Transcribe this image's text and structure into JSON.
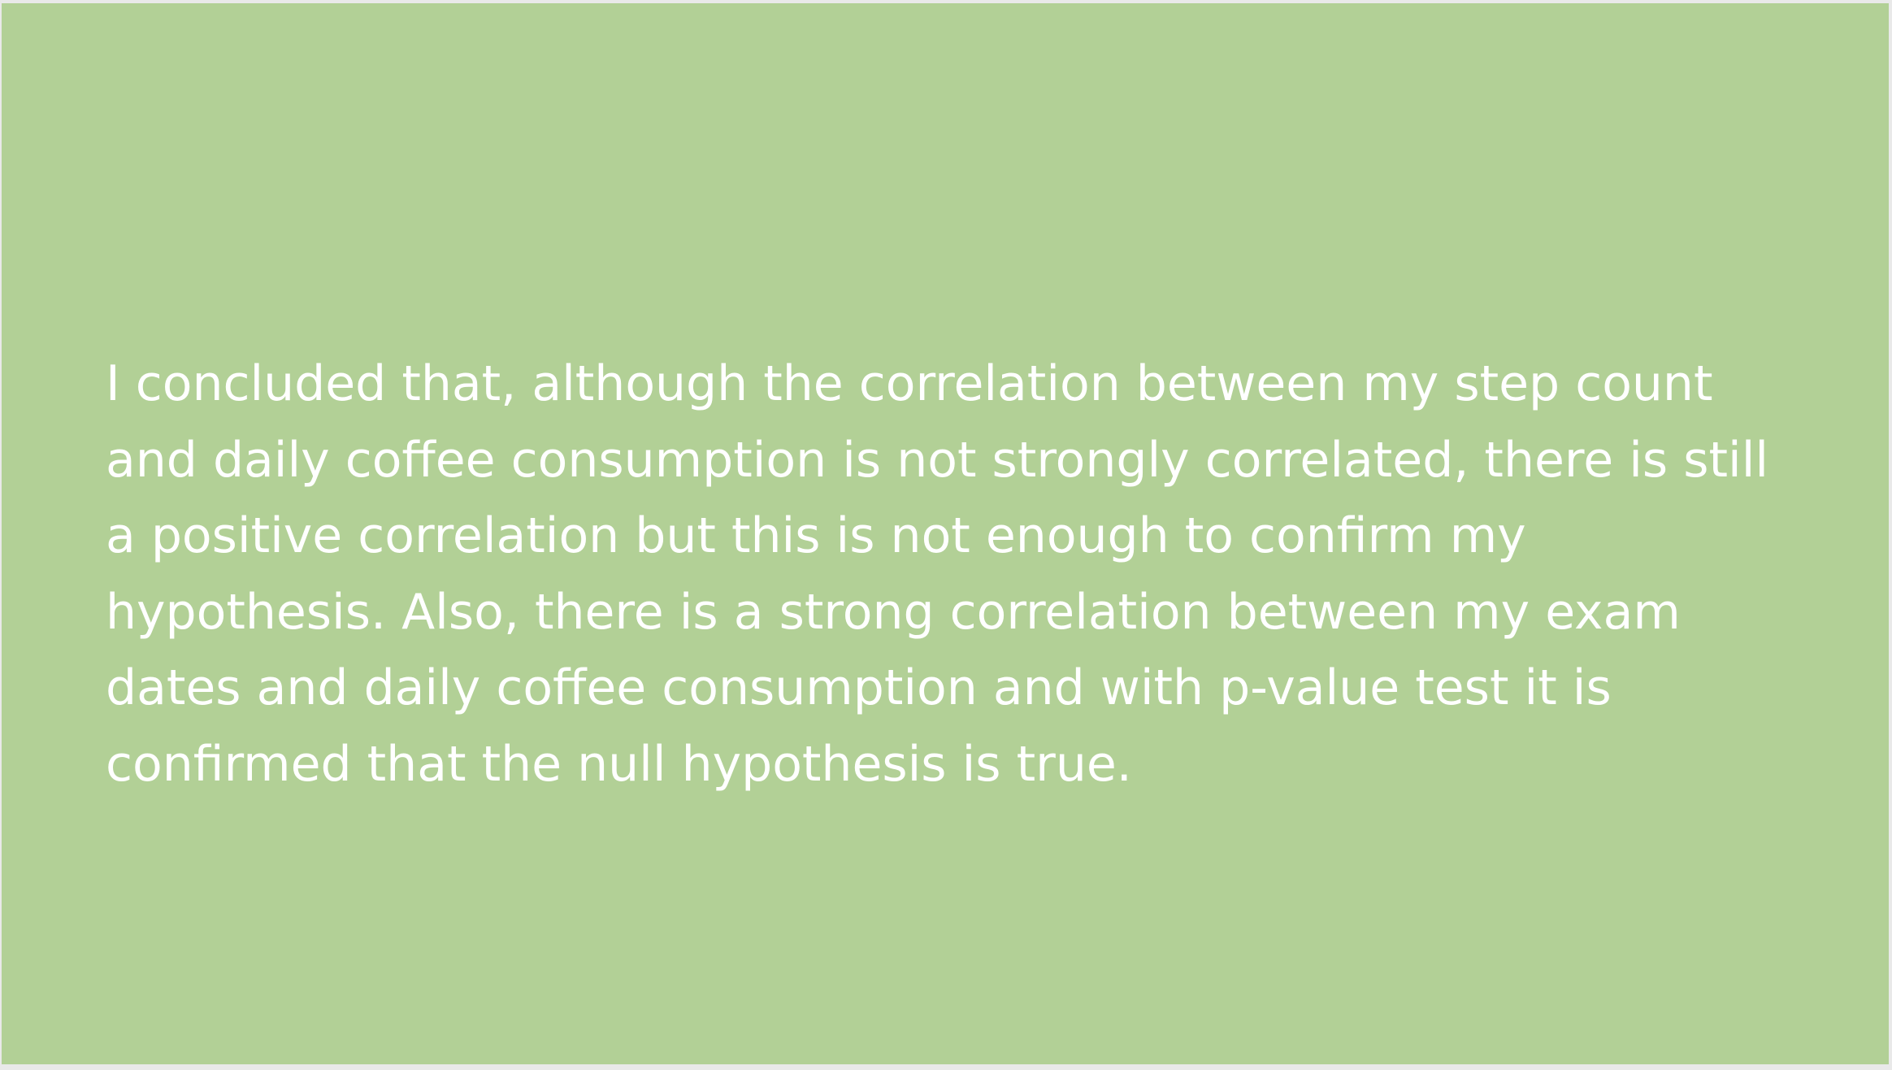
{
  "slide": {
    "background_color": "#b2d096",
    "text_color": "#ffffff",
    "body_lines": [
      "I concluded that, although the correlation between my step count",
      "and daily coffee consumption is not strongly correlated, there is still",
      "a positive correlation but this is not enough to confirm my",
      "hypothesis. Also, there is a strong correlation between my exam",
      "dates and daily coffee consumption and with p-value test it is",
      "confirmed that the null hypothesis is true."
    ]
  }
}
